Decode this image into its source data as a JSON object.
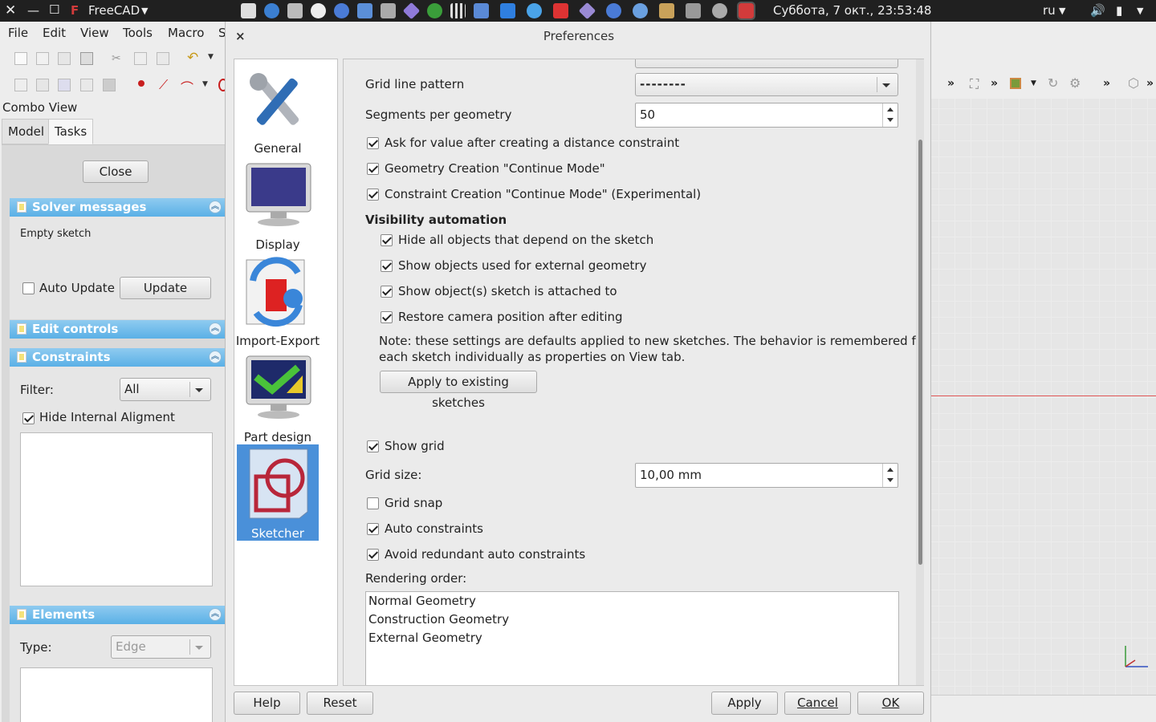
{
  "topbar": {
    "app_name": "FreeCAD",
    "clock": "Суббота,  7 окт., 23:53:48",
    "lang": "ru"
  },
  "menubar": {
    "file": "File",
    "edit": "Edit",
    "view": "View",
    "tools": "Tools",
    "macro": "Macro",
    "cut": "S"
  },
  "combo": {
    "title": "Combo View",
    "tab_model": "Model",
    "tab_tasks": "Tasks",
    "close": "Close",
    "solver": {
      "title": "Solver messages",
      "msg": "Empty sketch",
      "auto_update": "Auto Update",
      "update": "Update"
    },
    "edit_controls": "Edit controls",
    "constraints": {
      "title": "Constraints",
      "filter_label": "Filter:",
      "filter_value": "All",
      "hide_internal": "Hide Internal Aligment"
    },
    "elements": {
      "title": "Elements",
      "type_label": "Type:",
      "type_value": "Edge"
    }
  },
  "dialog": {
    "title": "Preferences",
    "close_glyph": "×",
    "categories": [
      {
        "label": "General"
      },
      {
        "label": "Display"
      },
      {
        "label": "Import-Export"
      },
      {
        "label": "Part design"
      },
      {
        "label": "Sketcher"
      }
    ],
    "grid_line_pattern": {
      "label": "Grid line pattern",
      "value": "--------"
    },
    "segments": {
      "label": "Segments per geometry",
      "value": "50"
    },
    "ask_value": "Ask for value after creating a distance constraint",
    "geom_continue": "Geometry Creation \"Continue Mode\"",
    "constr_continue": "Constraint Creation \"Continue Mode\" (Experimental)",
    "visibility": {
      "heading": "Visibility automation",
      "hide_depend": "Hide all objects that depend on the sketch",
      "show_external": "Show objects used for external geometry",
      "show_attached": "Show object(s) sketch is attached to",
      "restore_camera": "Restore camera position after editing",
      "note_line1": "Note: these settings are defaults applied to new sketches. The behavior is remembered for",
      "note_line2": "each sketch individually as properties on View tab.",
      "apply_existing": "Apply to existing sketches"
    },
    "show_grid": "Show grid",
    "grid_size": {
      "label": "Grid size:",
      "value": "10,00 mm"
    },
    "grid_snap": "Grid snap",
    "auto_constraints": "Auto constraints",
    "avoid_redundant": "Avoid redundant auto constraints",
    "rendering_order": {
      "label": "Rendering order:",
      "items": [
        "Normal Geometry",
        "Construction Geometry",
        "External Geometry"
      ]
    },
    "buttons": {
      "help": "Help",
      "reset": "Reset",
      "apply": "Apply",
      "cancel": "Cancel",
      "ok": "OK"
    }
  },
  "colors": {
    "accent": "#4a90d9",
    "panel_header": "#5ab0e6",
    "axis_red": "#e05555"
  }
}
